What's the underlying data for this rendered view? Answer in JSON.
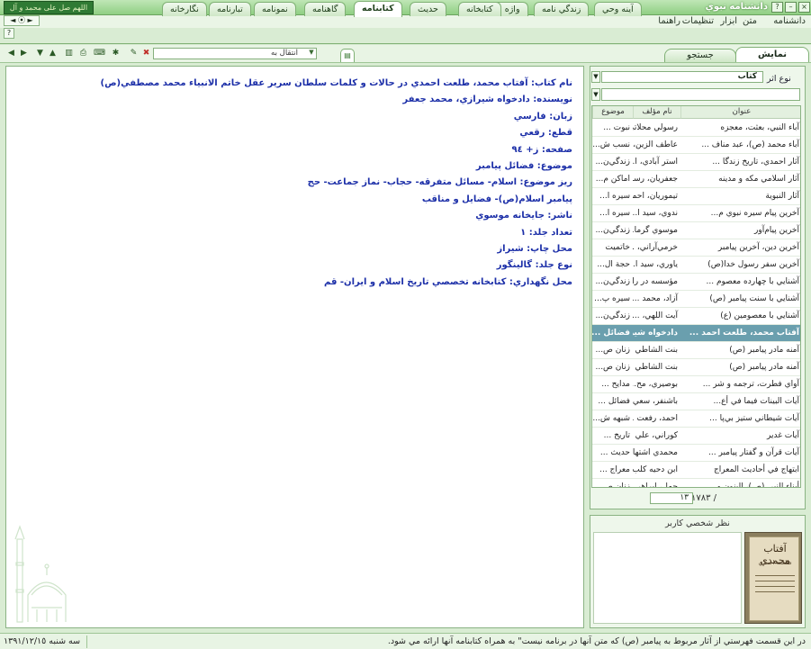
{
  "app": {
    "title": "دانشنامه نبوي",
    "logo_text": "اللهم صل على محمد و آل محمد"
  },
  "window_controls": {
    "help": "?",
    "minimize": "–",
    "close": "×"
  },
  "mini_controls": {
    "nav": "◄ ⦿ ►",
    "help": "?"
  },
  "menu": {
    "items": [
      "دانشنامه",
      "متن",
      "ابزار",
      "تنظيمات",
      "راهنما"
    ]
  },
  "top_tabs": [
    "آينه وحي",
    "زندگي نامه",
    "واژه نامه",
    "كتابخانه",
    "حديث",
    "كتابنامه",
    "گاهنامه",
    "نمونامه",
    "تبارنامه",
    "نگارخانه"
  ],
  "active_top_tab": "كتابنامه",
  "toolbar": {
    "goto_placeholder": "انتقال به",
    "icons": [
      "back-icon",
      "forward-icon",
      "down-icon",
      "up-icon",
      "columns-icon",
      "print-icon",
      "keyboard-icon",
      "highlight-icon",
      "edit-icon",
      "close-doc-icon"
    ]
  },
  "right_tabs": {
    "show": "نمايش",
    "search": "جستجو"
  },
  "document": {
    "lines": [
      "نام كتاب: آفتاب محمد، طلعت احمدي در حالات و كلمات سلطان سرير عقل خاتم الانبياء محمد مصطفي(ص)",
      "نويسنده: دادخواه شيرازي، محمد جعفر",
      "زبان: فارسي",
      "قطع: رقعي",
      "صفحه: ز+ ٩٤",
      "موضوع: فضائل پيامبر",
      "ريز موضوع: اسلام- مسائل متفرقه- حجاب- نماز جماعت- حج",
      "پيامبر اسلام(ص)- فضايل و مناقب",
      "ناشر: جايخانه موسوي",
      "تعداد جلد: ١",
      "محل چاپ: شيراز",
      "نوع جلد: گالينگور",
      "محل نگهداري: كتابخانه تخصصي تاريخ اسلام و ايران- قم"
    ]
  },
  "filter": {
    "type_label": "نوع اثر",
    "type_value": "كتاب",
    "search_value": ""
  },
  "grid": {
    "headers": {
      "title": "عنوان",
      "author": "نام مؤلف",
      "subject": "موضوع"
    },
    "rows": [
      {
        "title": "آباء النبي، بعثت، معجزه",
        "author": "رسولي محلاتي ...",
        "subject": "نبوت ..."
      },
      {
        "title": "آباء محمد (ص)، عبد مناف ...",
        "author": "عاطف الزين، ...",
        "subject": "نسب ش..."
      },
      {
        "title": "آثار احمدي، تاريخ زندگا ...",
        "author": "استر آبادي، ا...",
        "subject": "زندگي‌ن..."
      },
      {
        "title": "آثار اسلامي مكه و مدينه",
        "author": "جعفريان، رسول",
        "subject": "اماكن م..."
      },
      {
        "title": "آثار النبوية",
        "author": "تيموريان، احمد",
        "subject": "سيره ا..."
      },
      {
        "title": "آخرين پيام سيره نبوي م...",
        "author": "ندوي، سيد ا...",
        "subject": "سيره ا..."
      },
      {
        "title": "آخرين پيام‌آور",
        "author": "موسوي گرما...",
        "subject": "زندگي‌ن..."
      },
      {
        "title": "آخرين دين، آخرين پيامبر",
        "author": "خرمي‌آراني، ...",
        "subject": "خاتميت"
      },
      {
        "title": "آخرين سفر رسول خدا(ص)",
        "author": "ياوري، سيد ا...",
        "subject": "حجة ال..."
      },
      {
        "title": "آشنايي با چهارده معصوم ...",
        "author": "مؤسسه در را...",
        "subject": "زندگي‌ن..."
      },
      {
        "title": "آشنايي با سنت پيامبر (ص)",
        "author": "آزاد، محمد ...",
        "subject": "سيره پ..."
      },
      {
        "title": "آشنايي با معصومين (ع)",
        "author": "آيت اللهي، ...",
        "subject": "زندگي‌ن..."
      },
      {
        "title": "آفتاب محمد، طلعت احمد ...",
        "author": "دادخواه شيرا...",
        "subject": "فضائل ..."
      },
      {
        "title": "آمنه مادر پيامبر (ص)",
        "author": "بنت الشاطي ...",
        "subject": "زنان ص..."
      },
      {
        "title": "آمنه مادر پيامبر (ص)",
        "author": "بنت الشاطي",
        "subject": "زنان ص..."
      },
      {
        "title": "آواي فطرت، ترجمه و شر ...",
        "author": "بوصيري، مح...",
        "subject": "مدايح ..."
      },
      {
        "title": "آيات البينات فيما في أع...",
        "author": "باشنفر، سعي...",
        "subject": "فضائل ..."
      },
      {
        "title": "آيات شيطاني ستيز بي‌پا ...",
        "author": "احمد، رفعت ...",
        "subject": "شبهه ش..."
      },
      {
        "title": "آيات غدير",
        "author": "كوراني، علي",
        "subject": "تاريخ ..."
      },
      {
        "title": "آيات قرآن و گفتار پيامبر ...",
        "author": "محمدي اشتها...",
        "subject": "حديث ..."
      },
      {
        "title": "ابتهاج في أحاديث المعراج",
        "author": "ابن دحيه كلب...",
        "subject": "معراج ..."
      },
      {
        "title": "أبناء النبي (ص)، البنون و ...",
        "author": "جمل، ابراهي...",
        "subject": "زنان ص..."
      }
    ],
    "selected_index": 12
  },
  "pager": {
    "total": "/ ١٧٨٣",
    "current": "١٣"
  },
  "notes": {
    "title": "نظر شخصي كاربر",
    "cover_title": "آفتاب محمدي",
    "cover_author": "طلعت احمدي"
  },
  "status": {
    "message": "در اين قسمت فهرستي از آثار مربوط به پيامبر (ص) كه متن آنها در برنامه نيست\" به همراه كتابنامه آنها ارائه مي شود.",
    "date": "سه شنبه ١٣٩١/١٢/١٥"
  },
  "colors": {
    "accent": "#8fcf83",
    "doc_text": "#1c2fa8",
    "selection": "#6a9fae"
  }
}
